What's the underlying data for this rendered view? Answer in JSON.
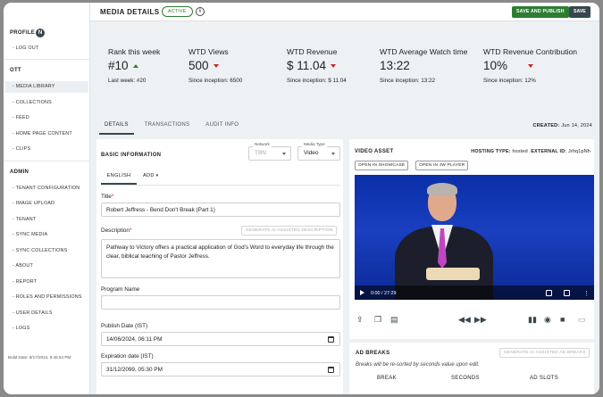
{
  "sidebar": {
    "profile": "PROFILE",
    "avatar_initial": "N",
    "logout": "- LOG OUT",
    "ott_heading": "OTT",
    "ott_items": [
      "- MEDIA LIBRARY",
      "- COLLECTIONS",
      "- FEED",
      "- HOME PAGE CONTENT",
      "- CLIPS"
    ],
    "admin_heading": "ADMIN",
    "admin_items": [
      "- TENANT CONFIGURATION",
      "- IMAGE UPLOAD",
      "- TENANT",
      "- SYNC MEDIA",
      "- SYNC COLLECTIONS",
      "- ABOUT",
      "- REPORT",
      "- ROLES AND PERMISSIONS",
      "- USER DETAILS",
      "- LOGS"
    ],
    "build": "Build Date: 6/17/2024, 5:46:54 PM"
  },
  "header": {
    "title": "MEDIA DETAILS",
    "status": "ACTIVE",
    "save_publish": "SAVE AND PUBLISH",
    "save": "SAVE"
  },
  "stats": [
    {
      "label": "Rank this week",
      "value": "#10",
      "trend": "up",
      "sub": "Last week: #20"
    },
    {
      "label": "WTD Views",
      "value": "500",
      "trend": "down",
      "sub": "Since inception: 6500"
    },
    {
      "label": "WTD Revenue",
      "value": "$ 11.04",
      "trend": "down",
      "sub": "Since inception: $ 11.04"
    },
    {
      "label": "WTD Average Watch time",
      "value": "13:22",
      "trend": "none",
      "sub": "Since inception: 13:22"
    },
    {
      "label": "WTD Revenue Contribution",
      "value": "10%",
      "trend": "down",
      "sub": "Since inception: 12%"
    }
  ],
  "tabs": [
    "DETAILS",
    "TRANSACTIONS",
    "AUDIT INFO"
  ],
  "created": {
    "label": "CREATED:",
    "value": "Jun 14, 2024"
  },
  "basic": {
    "heading": "BASIC INFORMATION",
    "network_caption": "Network",
    "network_value": "TBN",
    "media_type_caption": "Media Type",
    "media_type_value": "Video",
    "lang_tab": "ENGLISH",
    "add_tab": "ADD",
    "title_label": "Title",
    "title_value": "Robert Jeffress - Bend Don't Break (Part 1)",
    "desc_label": "Description",
    "gen_desc": "GENERATE AI-ASSISTED DESCRIPTION",
    "desc_value": "Pathway to Victory offers a practical application of God's Word to everyday life through the clear, biblical teaching of Pastor Jeffress.",
    "program_label": "Program Name",
    "program_value": "",
    "publish_label": "Publish Date (IST)",
    "publish_value": "14/06/2024, 06:11 PM",
    "expire_label": "Expiration date (IST)",
    "expire_value": "31/12/2099, 05:30 PM"
  },
  "video": {
    "heading": "VIDEO ASSET",
    "hosting_label": "HOSTING TYPE:",
    "hosting_value": "hosted",
    "ext_label": "EXTERNAL ID:",
    "ext_value": "Jrhq1pNh",
    "btn_showcase": "OPEN IN SHOWCASE",
    "btn_jw": "OPEN IN JW PLAYER",
    "time": "0:00 / 27:29"
  },
  "ad_breaks": {
    "heading": "AD BREAKS",
    "gen_btn": "GENERATE AI-ASSISTED AD BREAKS",
    "note": "Breaks will be re-sorted by seconds value upon edit.",
    "col_break": "BREAK",
    "col_seconds": "SECONDS",
    "col_slots": "AD SLOTS"
  }
}
